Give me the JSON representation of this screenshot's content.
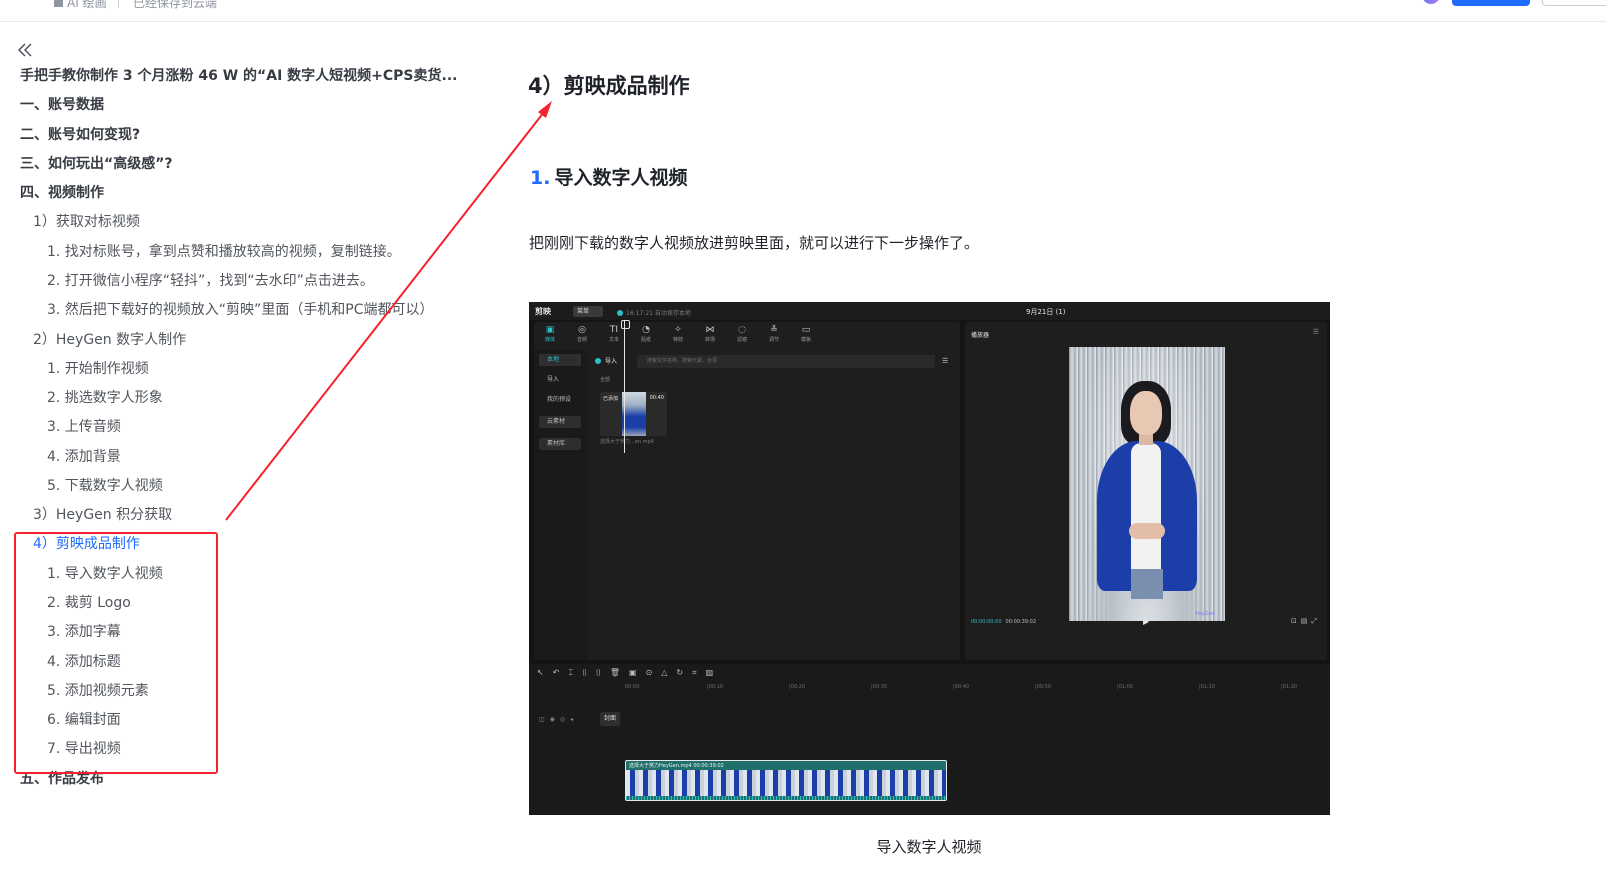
{
  "topbar": {
    "breadcrumb": "AI 绘画",
    "saved_status": "已经保存到云端"
  },
  "toc": {
    "items": [
      {
        "label": "手把手教你制作 3 个月涨粉 46 W 的“AI 数字人短视频+CPS卖货...",
        "level": 1
      },
      {
        "label": "一、账号数据",
        "level": 1
      },
      {
        "label": "二、账号如何变现?",
        "level": 1
      },
      {
        "label": "三、如何玩出“高级感”?",
        "level": 1
      },
      {
        "label": "四、视频制作",
        "level": 1
      },
      {
        "label": "1）获取对标视频",
        "level": 2
      },
      {
        "label": "1. 找对标账号，拿到点赞和播放较高的视频，复制链接。",
        "level": 3
      },
      {
        "label": "2. 打开微信小程序“轻抖”，找到“去水印”点击进去。",
        "level": 3
      },
      {
        "label": "3. 然后把下载好的视频放入“剪映”里面（手机和PC端都可以）",
        "level": 3
      },
      {
        "label": "2）HeyGen 数字人制作",
        "level": 2
      },
      {
        "label": "1. 开始制作视频",
        "level": 3
      },
      {
        "label": "2. 挑选数字人形象",
        "level": 3
      },
      {
        "label": "3. 上传音频",
        "level": 3
      },
      {
        "label": "4. 添加背景",
        "level": 3
      },
      {
        "label": "5. 下载数字人视频",
        "level": 3
      },
      {
        "label": "3）HeyGen 积分获取",
        "level": 2
      },
      {
        "label": "4）剪映成品制作",
        "level": 2,
        "active": true
      },
      {
        "label": "1. 导入数字人视频",
        "level": 3
      },
      {
        "label": "2. 裁剪 Logo",
        "level": 3
      },
      {
        "label": "3. 添加字幕",
        "level": 3
      },
      {
        "label": "4. 添加标题",
        "level": 3
      },
      {
        "label": "5. 添加视频元素",
        "level": 3
      },
      {
        "label": "6. 编辑封面",
        "level": 3
      },
      {
        "label": "7. 导出视频",
        "level": 3
      },
      {
        "label": "五、作品发布",
        "level": 1
      }
    ]
  },
  "doc": {
    "heading": "4）剪映成品制作",
    "subheading_num": "1.",
    "subheading": "导入数字人视频",
    "paragraph": "把刚刚下载的数字人视频放进剪映里面，就可以进行下一步操作了。",
    "caption": "导入数字人视频"
  },
  "editor": {
    "brand": "剪映",
    "menu_label": "菜单",
    "autosave": "16:17:21 自动保存本地",
    "project_name": "9月21日 (1)",
    "tools": [
      {
        "icon": "▣",
        "label": "媒体",
        "active": true
      },
      {
        "icon": "◎",
        "label": "音频"
      },
      {
        "icon": "TI",
        "label": "文本"
      },
      {
        "icon": "◔",
        "label": "贴纸"
      },
      {
        "icon": "✧",
        "label": "特效"
      },
      {
        "icon": "⋈",
        "label": "转场"
      },
      {
        "icon": "◌",
        "label": "滤镜"
      },
      {
        "icon": "≚",
        "label": "调节"
      },
      {
        "icon": "▭",
        "label": "模板"
      }
    ],
    "side_items": [
      "本地",
      "导入",
      "我的预设",
      "云素材",
      "素材库"
    ],
    "import_label": "导入",
    "search_placeholder": "搜索文件名称、搜索元素、台词",
    "all_label": "全部",
    "clip_tag": "已添加",
    "clip_duration": "00:40",
    "clip_name": "选择大于努力...en.mp4",
    "player_title": "播放器",
    "time_current": "00:00:00:00",
    "time_total": "00:00:39:02",
    "watermark": "HeyGen",
    "ruler_ticks": [
      "00:00",
      "|00:10",
      "|00:20",
      "|00:30",
      "|00:40",
      "|00:50",
      "|01:00",
      "|01:10",
      "|01:20"
    ],
    "cover_label": "封面",
    "track_clip_label": "选择大于努力HeyGen.mp4   00:00:39:02"
  },
  "colors": {
    "accent": "#1f6bff",
    "annotation_red": "#f5222d",
    "editor_teal": "#2bc0c8"
  }
}
